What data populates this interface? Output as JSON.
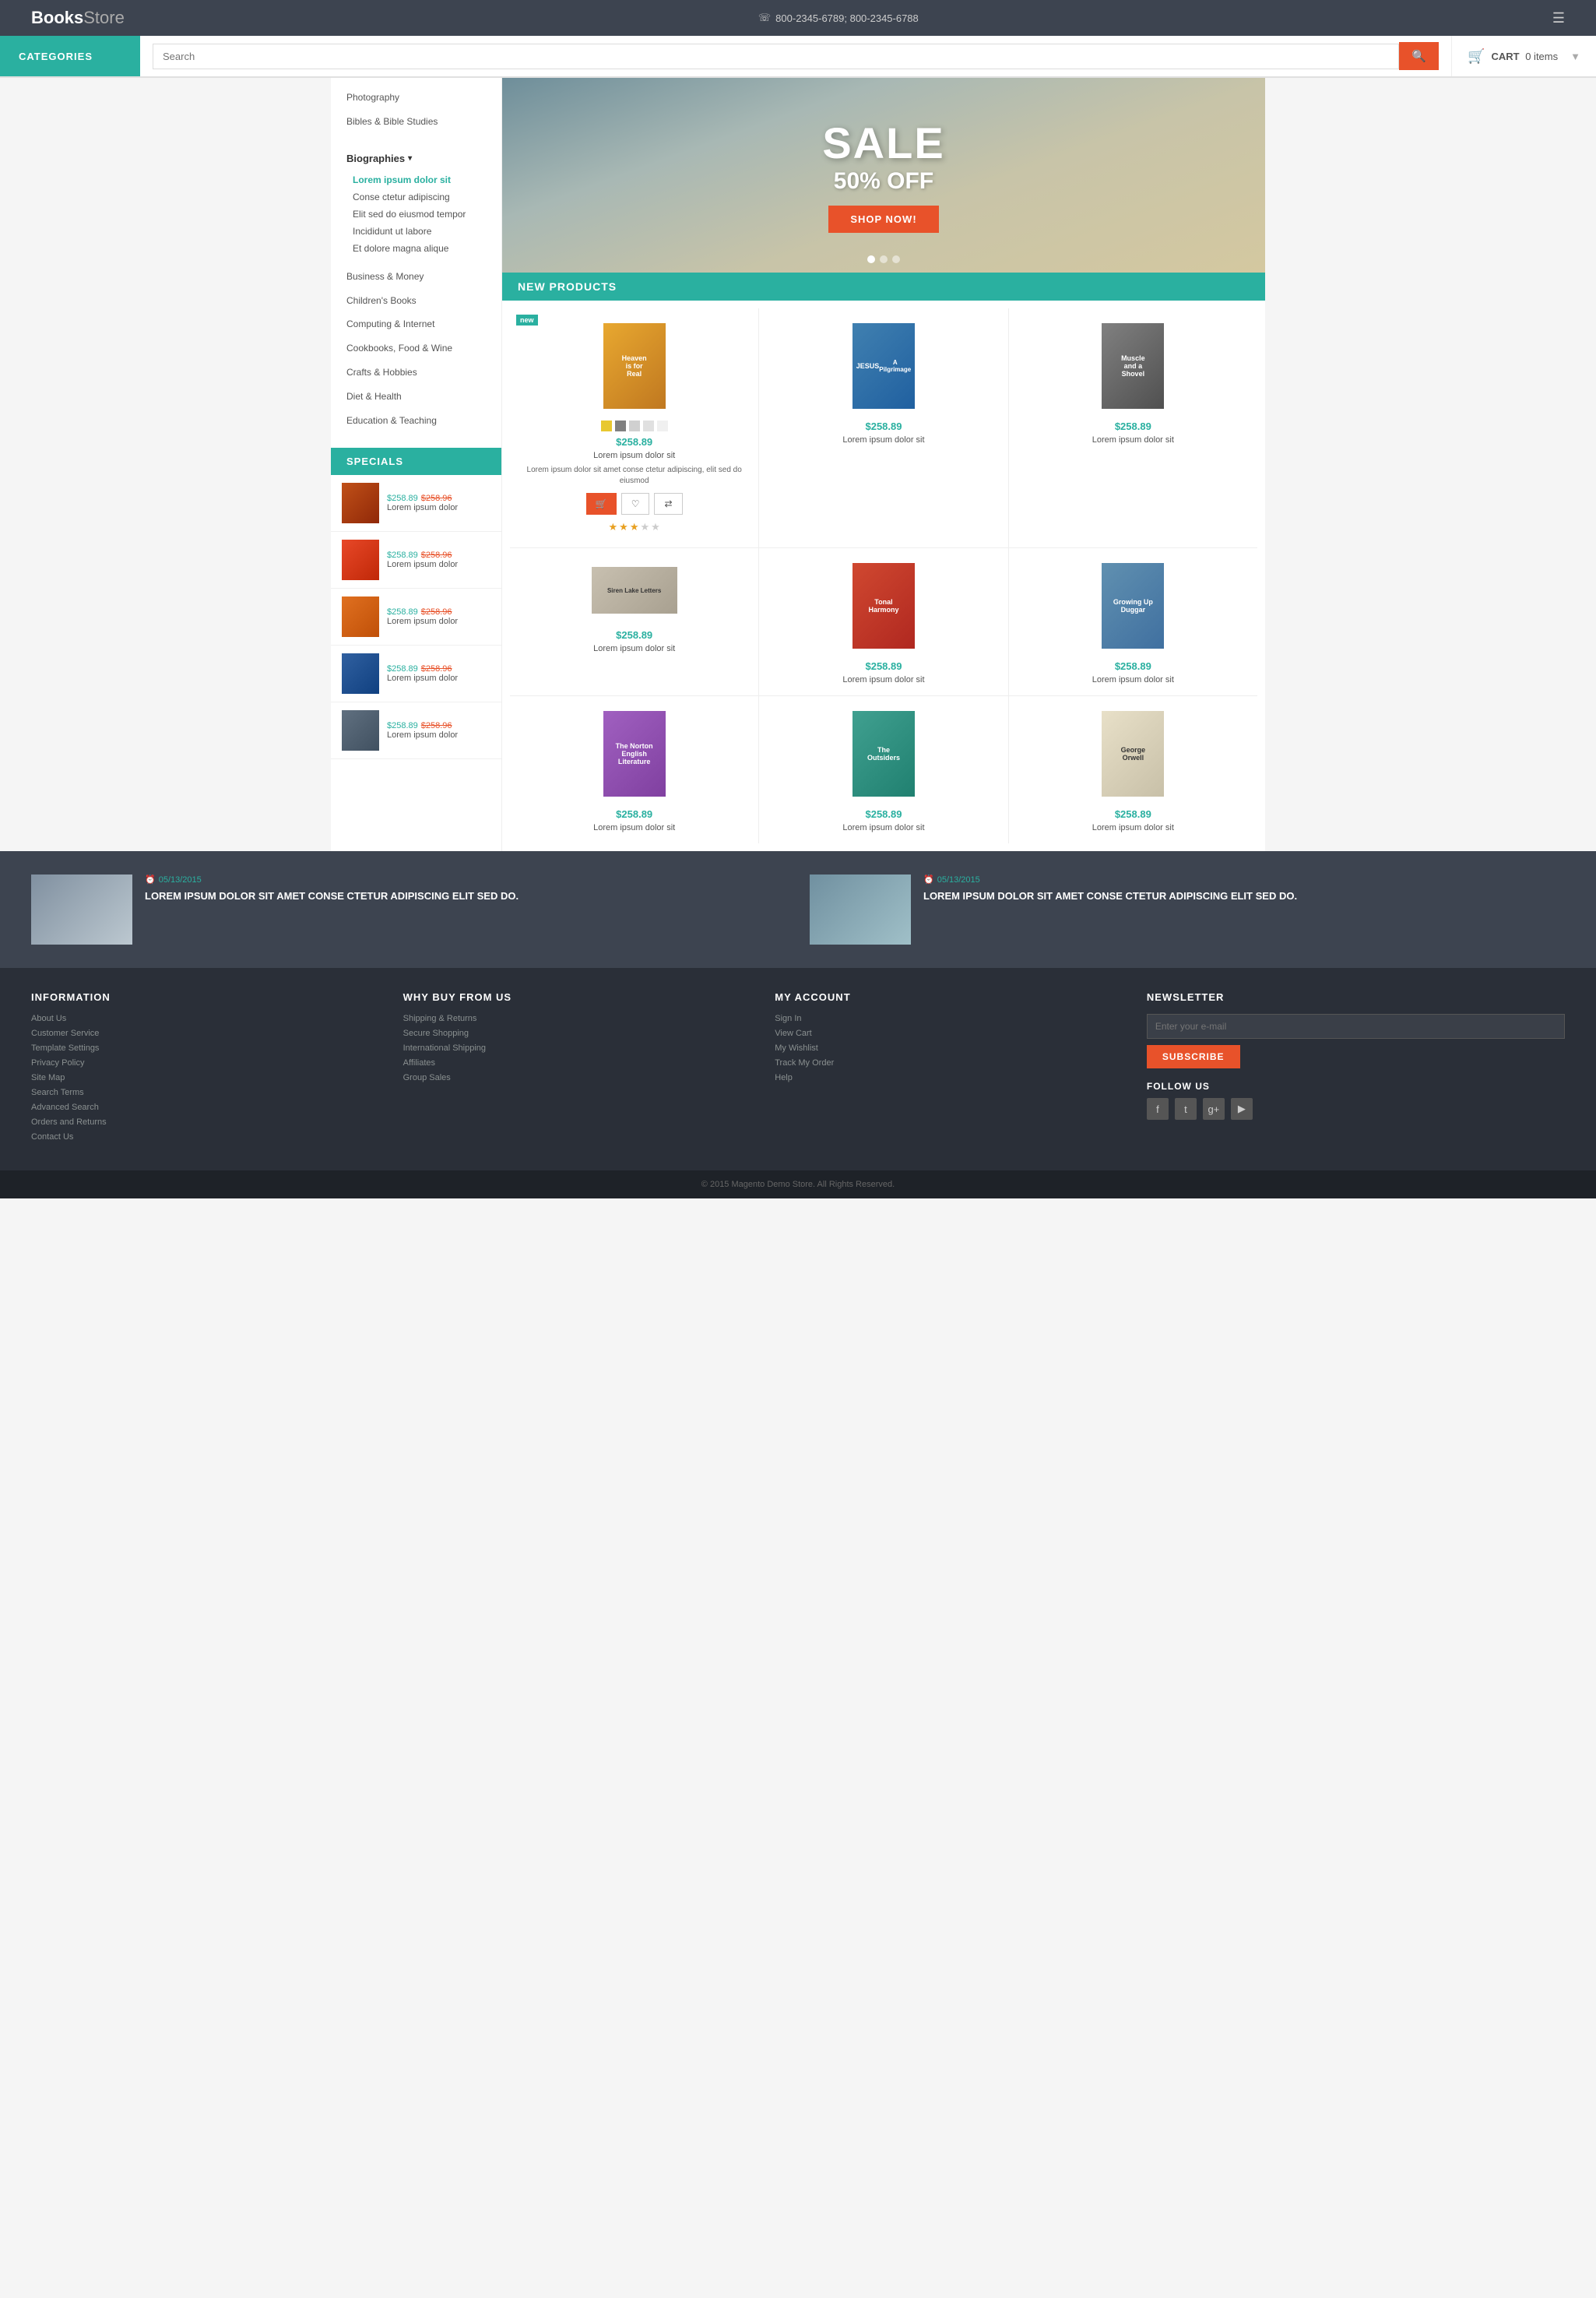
{
  "header": {
    "logo_bold": "Books",
    "logo_light": "Store",
    "phone": "800-2345-6789;  800-2345-6788",
    "phone_icon": "☏"
  },
  "navbar": {
    "categories_label": "CATEGORIES",
    "search_placeholder": "Search",
    "search_icon": "🔍",
    "cart_label": "CART",
    "cart_count": "0 items"
  },
  "sidebar": {
    "categories": [
      {
        "label": "Photography",
        "level": 1
      },
      {
        "label": "Bibles & Bible Studies",
        "level": 1
      },
      {
        "label": "Biographies",
        "level": 1,
        "has_sub": true
      },
      {
        "label": "Lorem ipsum dolor sit",
        "level": 2,
        "active": true
      },
      {
        "label": "Conse ctetur adipiscing",
        "level": 2
      },
      {
        "label": "Elit sed do eiusmod tempor",
        "level": 2
      },
      {
        "label": "Incididunt ut labore",
        "level": 2
      },
      {
        "label": "Et dolore magna alique",
        "level": 2
      },
      {
        "label": "Business & Money",
        "level": 1
      },
      {
        "label": "Children's Books",
        "level": 1
      },
      {
        "label": "Computing & Internet",
        "level": 1
      },
      {
        "label": "Cookbooks, Food & Wine",
        "level": 1
      },
      {
        "label": "Crafts & Hobbies",
        "level": 1
      },
      {
        "label": "Diet & Health",
        "level": 1
      },
      {
        "label": "Education & Teaching",
        "level": 1
      }
    ],
    "specials_label": "SPECIALS",
    "specials": [
      {
        "price": "$258.89",
        "old_price": "$258.96",
        "name": "Lorem ipsum dolor"
      },
      {
        "price": "$258.89",
        "old_price": "$258.96",
        "name": "Lorem ipsum dolor"
      },
      {
        "price": "$258.89",
        "old_price": "$258.96",
        "name": "Lorem ipsum dolor"
      },
      {
        "price": "$258.89",
        "old_price": "$258.96",
        "name": "Lorem ipsum dolor"
      },
      {
        "price": "$258.89",
        "old_price": "$258.96",
        "name": "Lorem ipsum dolor"
      }
    ]
  },
  "hero": {
    "sale_text": "SALE",
    "off_text": "50% OFF",
    "button_label": "SHOP NOW!"
  },
  "new_products": {
    "section_label": "NEW PRODUCTS",
    "badge_label": "new",
    "featured": {
      "price": "$258.89",
      "name": "Lorem ipsum dolor sit",
      "desc": "Lorem ipsum dolor sit amet conse ctetur adipiscing, elit sed do eiusmod",
      "colors": [
        "#e8c830",
        "#808080",
        "#d0d0d0",
        "#e0e0e0",
        "#f0f0f0"
      ],
      "stars": 3,
      "total_stars": 5
    },
    "products": [
      {
        "price": "$258.89",
        "name": "Lorem ipsum dolor sit"
      },
      {
        "price": "$258.89",
        "name": "Lorem ipsum dolor sit"
      },
      {
        "price": "$258.89",
        "name": "Lorem ipsum dolor sit"
      },
      {
        "price": "$258.89",
        "name": "Lorem ipsum dolor sit"
      },
      {
        "price": "$258.89",
        "name": "Lorem ipsum dolor sit"
      },
      {
        "price": "$258.89",
        "name": "Lorem ipsum dolor sit"
      },
      {
        "price": "$258.89",
        "name": "Lorem ipsum dolor sit"
      },
      {
        "price": "$258.89",
        "name": "Lorem ipsum dolor sit"
      }
    ]
  },
  "blog": {
    "items": [
      {
        "date": "05/13/2015",
        "title": "LOREM IPSUM DOLOR SIT AMET CONSE CTETUR ADIPISCING ELIT SED DO."
      },
      {
        "date": "05/13/2015",
        "title": "LOREM IPSUM DOLOR SIT AMET CONSE CTETUR ADIPISCING ELIT SED DO."
      }
    ]
  },
  "footer": {
    "information": {
      "heading": "INFORMATION",
      "links": [
        "About Us",
        "Customer Service",
        "Template Settings",
        "Privacy Policy",
        "Site Map",
        "Search Terms",
        "Advanced Search",
        "Orders and Returns",
        "Contact Us"
      ]
    },
    "why_buy": {
      "heading": "WHY BUY FROM US",
      "links": [
        "Shipping & Returns",
        "Secure Shopping",
        "International Shipping",
        "Affiliates",
        "Group Sales"
      ]
    },
    "my_account": {
      "heading": "MY ACCOUNT",
      "links": [
        "Sign In",
        "View Cart",
        "My Wishlist",
        "Track My Order",
        "Help"
      ]
    },
    "newsletter": {
      "heading": "NEWSLETTER",
      "placeholder": "Enter your e-mail",
      "button_label": "SUBSCRIBE",
      "follow_label": "FOLLOW US"
    },
    "social": [
      "f",
      "t",
      "g+",
      "▶"
    ],
    "copyright": "© 2015 Magento Demo Store. All Rights Reserved."
  }
}
